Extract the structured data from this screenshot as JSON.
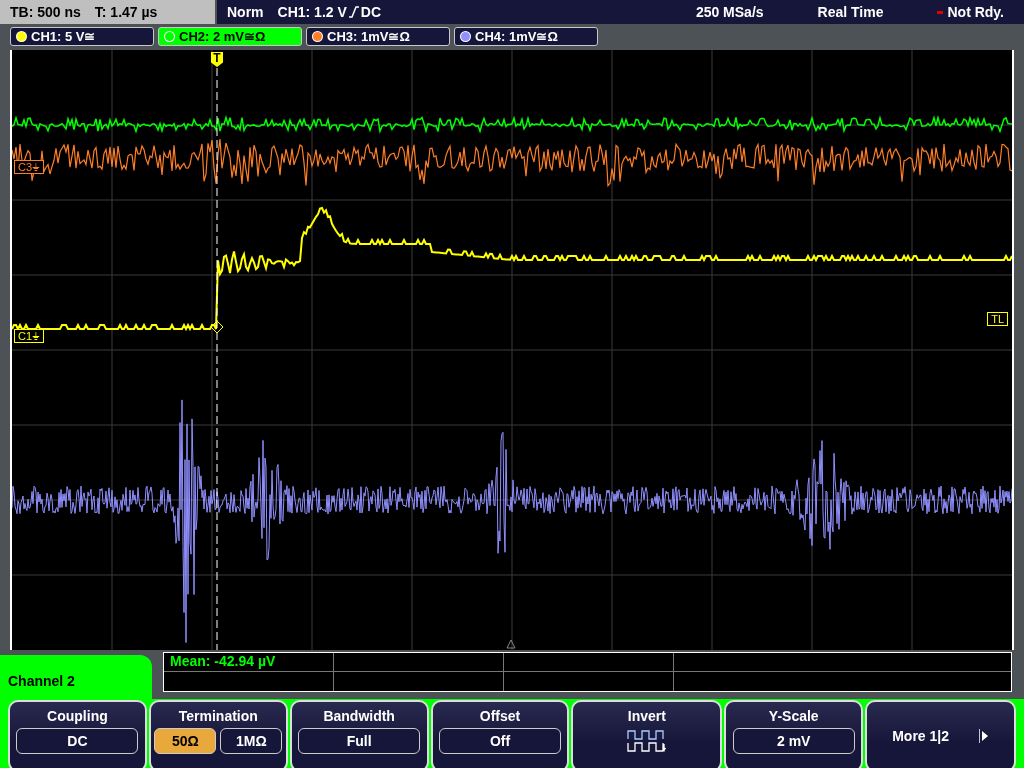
{
  "status_bar": {
    "timebase": "TB: 500 ns",
    "trigger_time": "T: 1.47 µs",
    "mode": "Norm",
    "trigger_source": "CH1: 1.2 V",
    "trigger_coupling": "DC",
    "sample_rate": "250 MSa/s",
    "acquisition": "Real Time",
    "state": "Not Rdy."
  },
  "channels": [
    {
      "label": "CH1: 5 V≅",
      "color": "#ffff00",
      "selected": false
    },
    {
      "label": "CH2: 2 mV≅Ω",
      "color": "#00ff00",
      "selected": true
    },
    {
      "label": "CH3: 1mV≅Ω",
      "color": "#ff7f27",
      "selected": false
    },
    {
      "label": "CH4: 1mV≅Ω",
      "color": "#9090ff",
      "selected": false
    }
  ],
  "display": {
    "trigger_marker": "T",
    "trigger_level_marker": "TL",
    "trace_labels": [
      {
        "label": "C3⏚",
        "color": "#ff7f27"
      },
      {
        "label": "C1⏚",
        "color": "#ffff00"
      }
    ]
  },
  "measurement": {
    "text": "Mean: -42.94 µV"
  },
  "menu": {
    "title": "Channel 2",
    "softkeys": [
      {
        "kind": "value",
        "title": "Coupling",
        "value": "DC"
      },
      {
        "kind": "toggle",
        "title": "Termination",
        "options": [
          {
            "label": "50Ω",
            "selected": true
          },
          {
            "label": "1MΩ",
            "selected": false
          }
        ]
      },
      {
        "kind": "value",
        "title": "Bandwidth",
        "value": "Full"
      },
      {
        "kind": "value",
        "title": "Offset",
        "value": "Off"
      },
      {
        "kind": "icon",
        "title": "Invert"
      },
      {
        "kind": "value",
        "title": "Y-Scale",
        "value": "2 mV"
      },
      {
        "kind": "more",
        "title": "More 1|2"
      }
    ]
  }
}
